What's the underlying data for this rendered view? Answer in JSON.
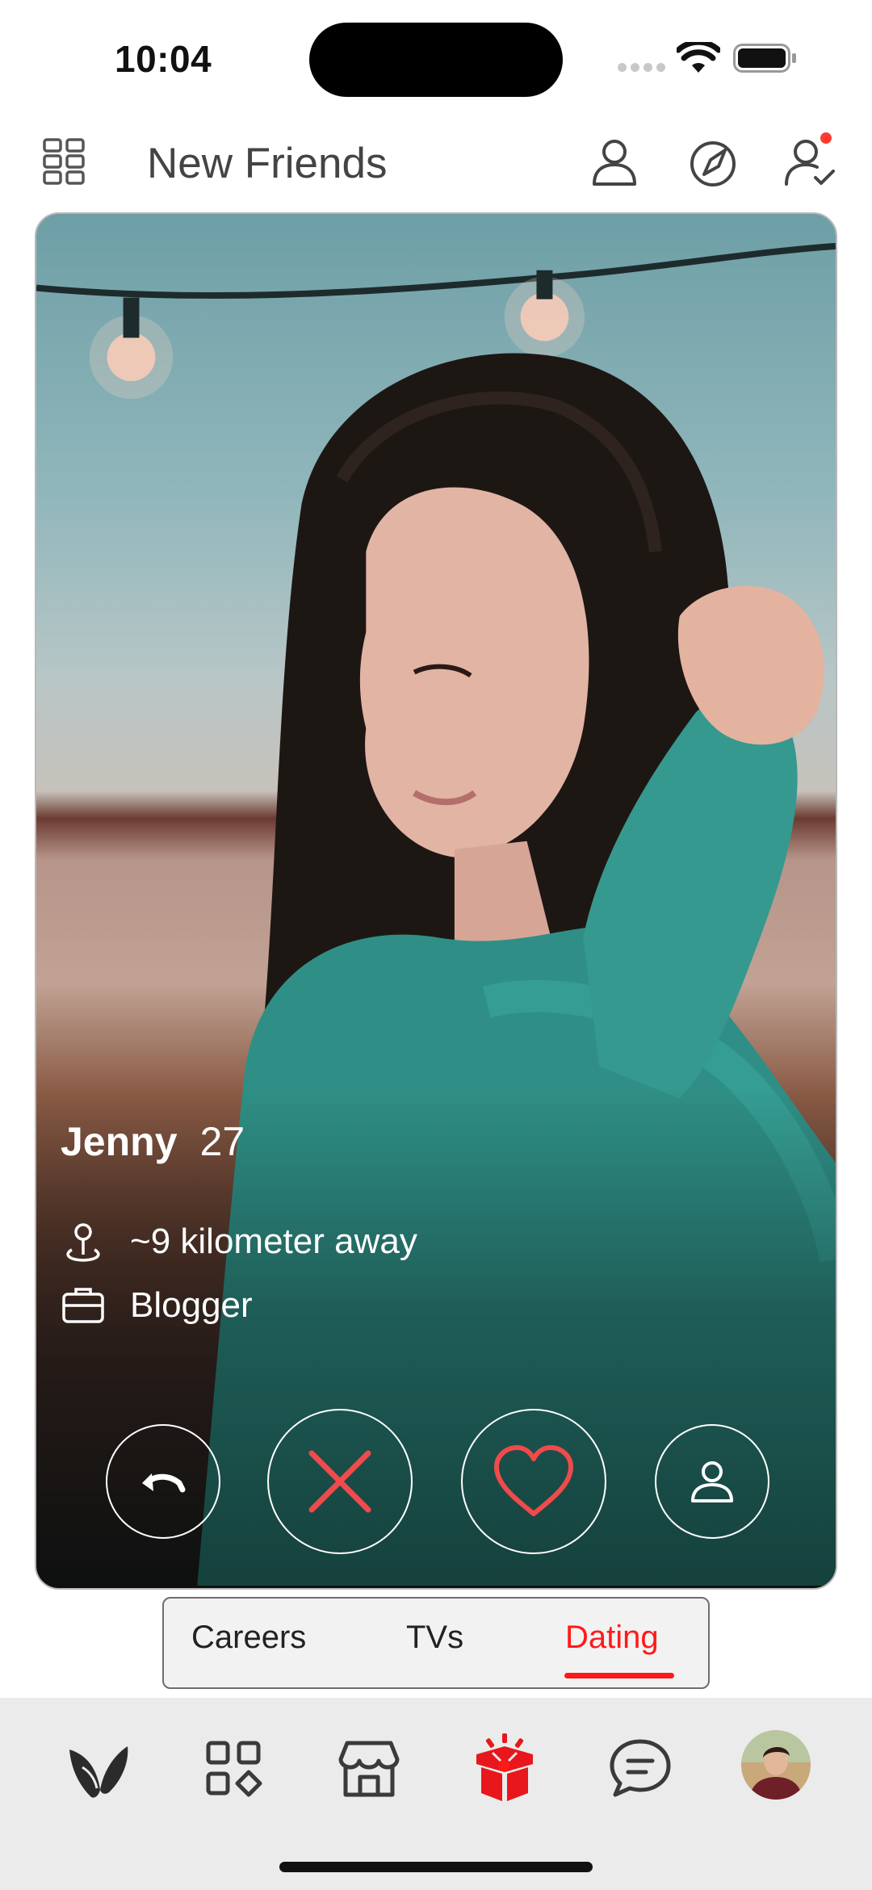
{
  "status_bar": {
    "time": "10:04"
  },
  "header": {
    "title": "New Friends",
    "icons": [
      "grid-menu-icon",
      "user-icon",
      "compass-icon",
      "user-check-icon"
    ],
    "notification_dot_color": "#ff3b30"
  },
  "profile": {
    "name": "Jenny",
    "age": "27",
    "distance": "~9 kilometer away",
    "occupation": "Blogger"
  },
  "actions": [
    "undo-icon",
    "close-icon",
    "heart-icon",
    "profile-icon"
  ],
  "tabs": {
    "items": [
      "Careers",
      "TVs",
      "Dating"
    ],
    "selected": "Dating"
  },
  "bottom_nav": {
    "items": [
      "logo-icon",
      "apps-icon",
      "store-icon",
      "gift-icon",
      "chat-icon",
      "avatar"
    ],
    "active": "gift-icon"
  },
  "colors": {
    "accent": "#ff1a1a",
    "action_red": "#f04a4a",
    "nav_background": "#ebebeb"
  }
}
